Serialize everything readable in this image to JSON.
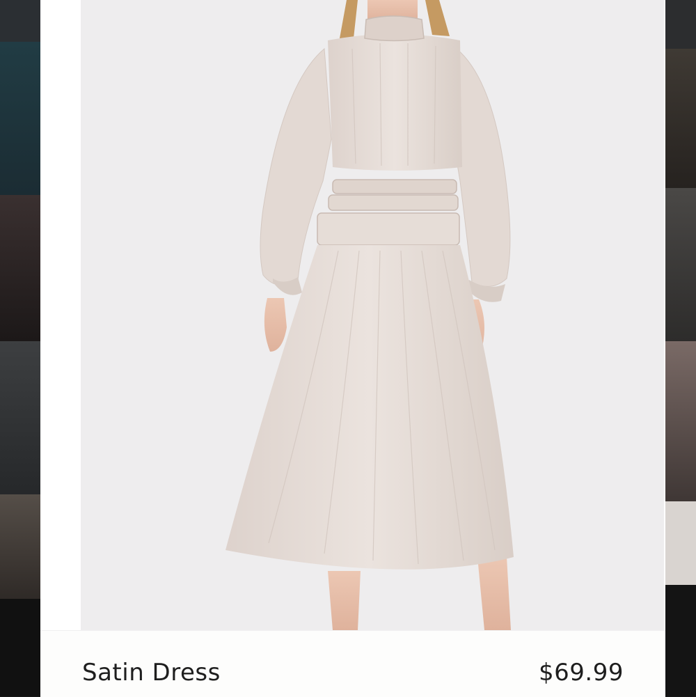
{
  "product": {
    "name": "Satin Dress",
    "price": "$69.99"
  },
  "colors": {
    "card_background": "#ffffff",
    "photo_background": "#eeedee",
    "dress": "#e6dcd6",
    "text": "#1e1e1e"
  }
}
